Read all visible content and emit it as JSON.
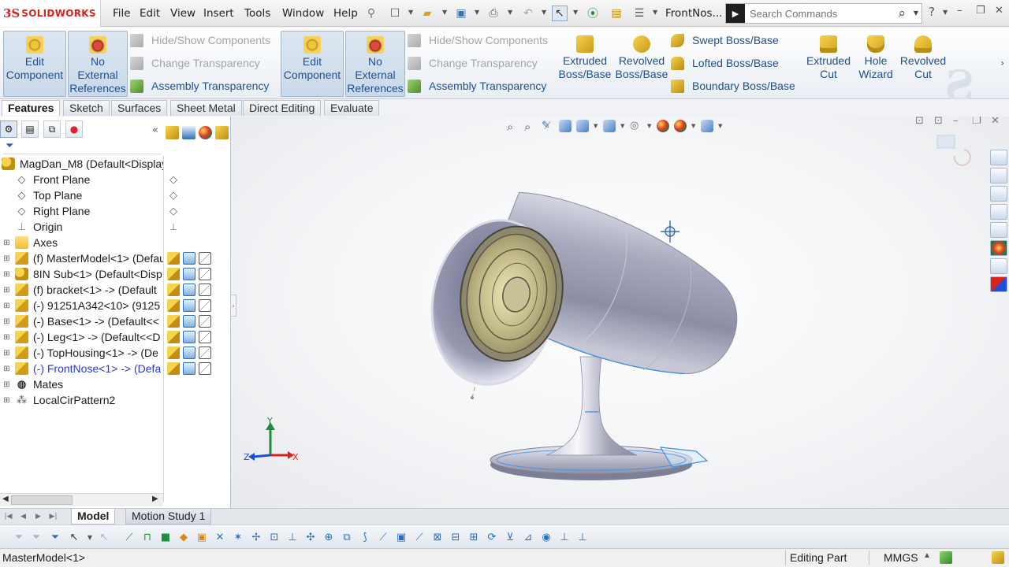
{
  "app": {
    "logo_prefix": "3S",
    "logo_text": "SOLIDWORKS",
    "document_title": "FrontNos..."
  },
  "menu": [
    "File",
    "Edit",
    "View",
    "Insert",
    "Tools",
    "Window",
    "Help"
  ],
  "search": {
    "placeholder": "Search Commands"
  },
  "command_manager": {
    "edit_component": "Edit\nComponent",
    "no_external_references": "No\nExternal\nReferences",
    "hide_show_components": "Hide/Show Components",
    "change_transparency": "Change Transparency",
    "assembly_transparency": "Assembly Transparency",
    "extruded_boss": "Extruded\nBoss/Base",
    "revolved_boss": "Revolved\nBoss/Base",
    "swept_boss": "Swept Boss/Base",
    "lofted_boss": "Lofted Boss/Base",
    "boundary_boss": "Boundary Boss/Base",
    "extruded_cut": "Extruded\nCut",
    "hole_wizard": "Hole\nWizard",
    "revolved_cut": "Revolved\nCut"
  },
  "cm_tabs": [
    "Features",
    "Sketch",
    "Surfaces",
    "Sheet Metal",
    "Direct Editing",
    "Evaluate"
  ],
  "tree": {
    "root": "MagDan_M8  (Default<Display",
    "items": [
      {
        "label": "Front Plane"
      },
      {
        "label": "Top Plane"
      },
      {
        "label": "Right Plane"
      },
      {
        "label": "Origin"
      },
      {
        "label": "Axes"
      },
      {
        "label": "(f) MasterModel<1> (Defau"
      },
      {
        "label": "8IN Sub<1> (Default<Disp"
      },
      {
        "label": "(f) bracket<1> -> (Default"
      },
      {
        "label": "(-) 91251A342<10> (9125"
      },
      {
        "label": "(-) Base<1> -> (Default<<"
      },
      {
        "label": "(-) Leg<1> -> (Default<<D"
      },
      {
        "label": "(-) TopHousing<1> -> (De"
      },
      {
        "label": "(-) FrontNose<1> -> (Defa"
      },
      {
        "label": "Mates"
      },
      {
        "label": "LocalCirPattern2"
      }
    ]
  },
  "triad": {
    "x": "X",
    "y": "Y",
    "z": "Z"
  },
  "bottom_tabs": [
    "Model",
    "Motion Study 1"
  ],
  "status": {
    "selection": "MasterModel<1>",
    "mode": "Editing Part",
    "units": "MMGS"
  },
  "colors": {
    "accent_blue": "#1d4f91",
    "highlight_item": "#2a3cc6",
    "edge_blue": "#3c8de0",
    "logo_red": "#d8231e"
  }
}
